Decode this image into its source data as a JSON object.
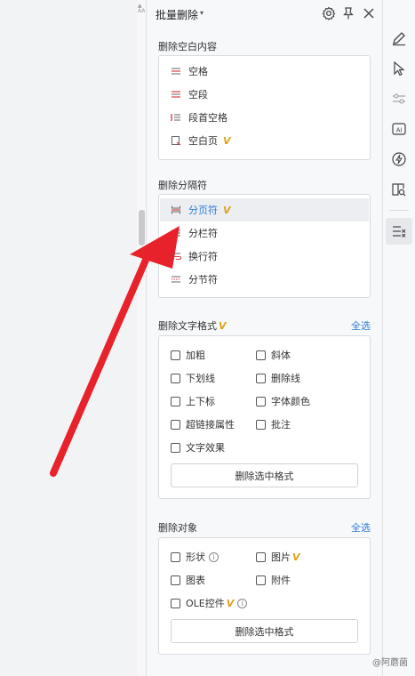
{
  "panel": {
    "title": "批量删除",
    "caret": "▾"
  },
  "empty_content": {
    "label": "删除空白内容",
    "items": [
      {
        "label": "空格",
        "icon": "space-icon"
      },
      {
        "label": "空段",
        "icon": "empty-paragraph-icon"
      },
      {
        "label": "段首空格",
        "icon": "leading-space-icon"
      },
      {
        "label": "空白页",
        "icon": "blank-page-icon",
        "vip": "V"
      }
    ]
  },
  "separators": {
    "label": "删除分隔符",
    "items": [
      {
        "label": "分页符",
        "icon": "page-break-icon",
        "vip": "V",
        "selected": true
      },
      {
        "label": "分栏符",
        "icon": "column-break-icon"
      },
      {
        "label": "换行符",
        "icon": "line-break-icon"
      },
      {
        "label": "分节符",
        "icon": "section-break-icon"
      }
    ]
  },
  "text_format": {
    "label": "删除文字格式",
    "vip": "V",
    "select_all": "全选",
    "options": [
      "加粗",
      "斜体",
      "下划线",
      "删除线",
      "上下标",
      "字体颜色",
      "超链接属性",
      "批注",
      "文字效果"
    ],
    "apply": "删除选中格式"
  },
  "objects": {
    "label": "删除对象",
    "select_all": "全选",
    "options": {
      "shape": "形状",
      "image": "图片",
      "chart": "图表",
      "attachment": "附件",
      "ole": "OLE控件"
    },
    "info_glyph": "i",
    "vip": "V",
    "apply": "删除选中格式"
  },
  "scrollbar_glyph": "▲\nAA",
  "watermark": "@阿蘑菌",
  "colors": {
    "accent": "#2f7bd6",
    "vip": "#e0a21b",
    "arrow": "#e8222a"
  }
}
